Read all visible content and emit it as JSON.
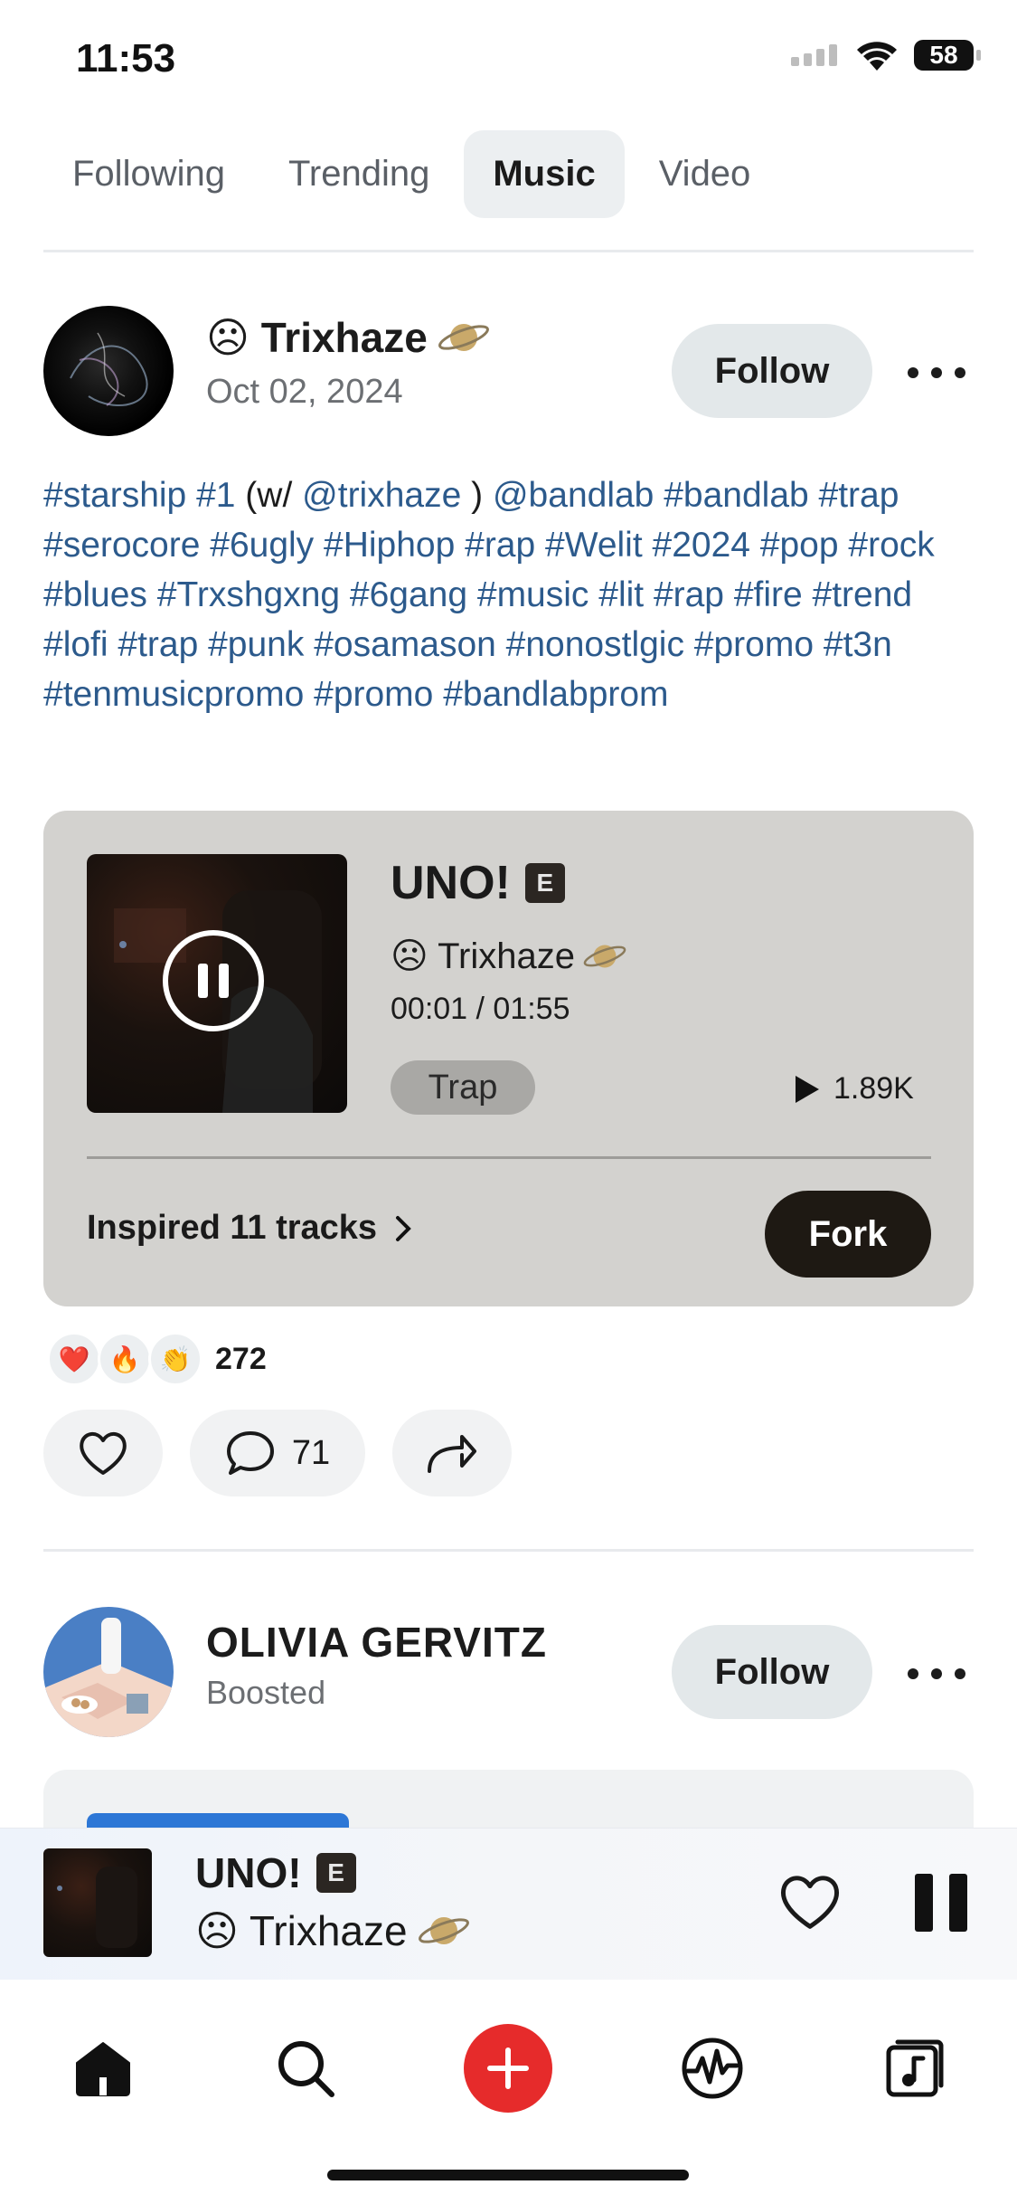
{
  "status_bar": {
    "time": "11:53",
    "battery": "58"
  },
  "tabs": [
    {
      "label": "Following",
      "active": false
    },
    {
      "label": "Trending",
      "active": false
    },
    {
      "label": "Music",
      "active": true
    },
    {
      "label": "Video",
      "active": false
    }
  ],
  "post1": {
    "author": "☹ Trixhaze",
    "author_badge_icon": "saturn-icon",
    "date": "Oct 02, 2024",
    "follow_label": "Follow",
    "caption": {
      "t1": "#starship #1",
      "t2": " (w/ ",
      "t3": "@trixhaze",
      "t4": " ) ",
      "t5": "@bandlab #bandlab #trap #serocore #6ugly #Hiphop #rap #Welit #2024 #pop #rock #blues #Trxshgxng #6gang  #music #lit #rap #fire #trend #lofi #trap #punk #osamason #nonostlgic #promo #t3n #tenmusicpromo #promo #bandlabprom"
    },
    "track": {
      "title": "UNO!",
      "explicit": "E",
      "artist": "☹ Trixhaze",
      "time": "00:01 / 01:55",
      "genre": "Trap",
      "plays": "1.89K",
      "inspired": "Inspired 11 tracks",
      "fork_label": "Fork"
    },
    "reactions": {
      "icons": [
        "❤️",
        "🔥",
        "👏"
      ],
      "count": "272"
    },
    "comments": "71"
  },
  "post2": {
    "author": "OLIVIA GERVITZ",
    "subtitle": "Boosted",
    "follow_label": "Follow"
  },
  "mini_player": {
    "title": "UNO!",
    "explicit": "E",
    "artist": "☹ Trixhaze"
  },
  "nav": [
    "home-icon",
    "search-icon",
    "add-icon",
    "feed-icon",
    "library-icon"
  ],
  "colors": {
    "accent_red": "#e62b2b",
    "link_blue": "#2c5a8c",
    "card_gray": "#d3d2cf",
    "fork_dark": "#1e1913"
  }
}
